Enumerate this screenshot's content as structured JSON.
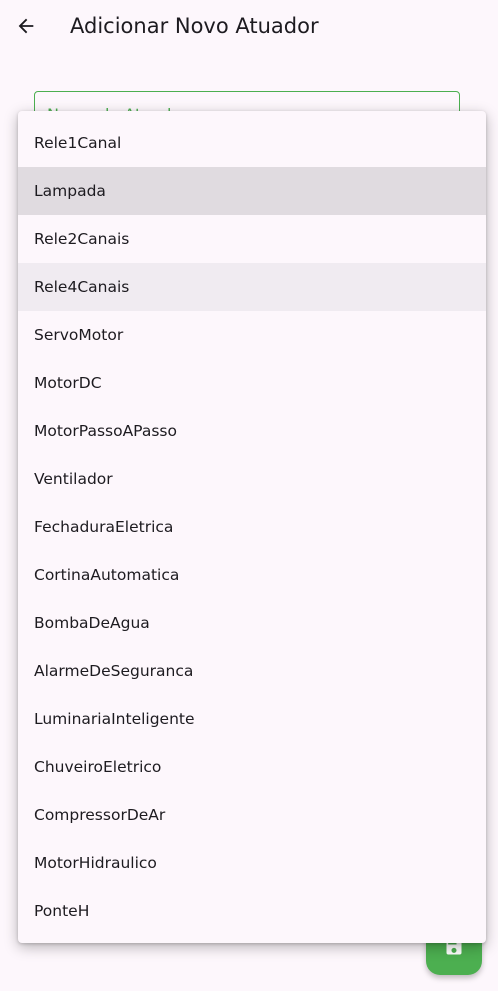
{
  "app_bar": {
    "title": "Adicionar Novo Atuador",
    "back_icon": "arrow-left-icon"
  },
  "name_field": {
    "label": "Nome do Atuador",
    "border_color": "#4caf50"
  },
  "dropdown": {
    "selected": "Lampada",
    "hovered": "Rele4Canais",
    "items": [
      "Rele1Canal",
      "Lampada",
      "Rele2Canais",
      "Rele4Canais",
      "ServoMotor",
      "MotorDC",
      "MotorPassoAPasso",
      "Ventilador",
      "FechaduraEletrica",
      "CortinaAutomatica",
      "BombaDeAgua",
      "AlarmeDeSeguranca",
      "LuminariaInteligente",
      "ChuveiroEletrico",
      "CompressorDeAr",
      "MotorHidraulico",
      "PonteH"
    ]
  },
  "fab": {
    "icon": "save-icon",
    "color": "#4caf50"
  }
}
